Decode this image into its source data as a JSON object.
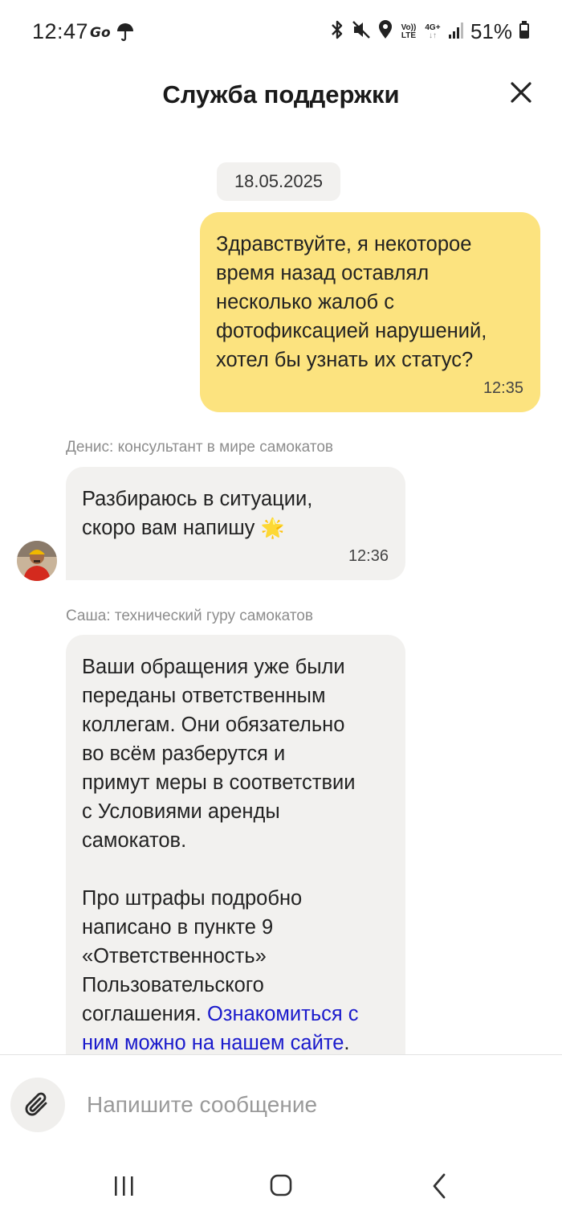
{
  "status_bar": {
    "time": "12:47",
    "lte_top": "Vo))",
    "lte_bottom": "LTE",
    "net_type": "4G+",
    "battery_percent": "51%",
    "icons": [
      "go-icon",
      "umbrella-icon",
      "bluetooth-icon",
      "mute-icon",
      "location-icon",
      "signal-icon",
      "battery-icon"
    ]
  },
  "header": {
    "title": "Служба поддержки"
  },
  "chat": {
    "date": "18.05.2025",
    "messages": [
      {
        "direction": "outgoing",
        "text": "Здравствуйте, я некоторое\nвремя назад оставлял\nнесколько жалоб с\nфотофиксацией нарушений,\nхотел бы узнать их статус?",
        "time": "12:35"
      },
      {
        "direction": "incoming",
        "sender": "Денис: консультант в мире самокатов",
        "text": "Разбираюсь в ситуации,\nскоро вам напишу",
        "emoji": "🌟",
        "time": "12:36"
      },
      {
        "direction": "incoming",
        "sender": "Саша: технический гуру самокатов",
        "text": "Ваши обращения уже были\nпереданы ответственным\nколлегам. Они обязательно\nво всём разберутся и\nпримут меры в соответствии\nс Условиями аренды\nсамокатов.",
        "text2": "Про штрафы подробно\nнаписано в пункте 9\n«Ответственность»\nПользовательского\nсоглашения. ",
        "link_text": "Ознакомиться с\nним можно на нашем сайте",
        "after_link": "."
      }
    ]
  },
  "input": {
    "placeholder": "Напишите сообщение"
  },
  "colors": {
    "outgoing_bubble": "#fce37f",
    "incoming_bubble": "#f2f1ef",
    "link": "#1a1acc"
  }
}
